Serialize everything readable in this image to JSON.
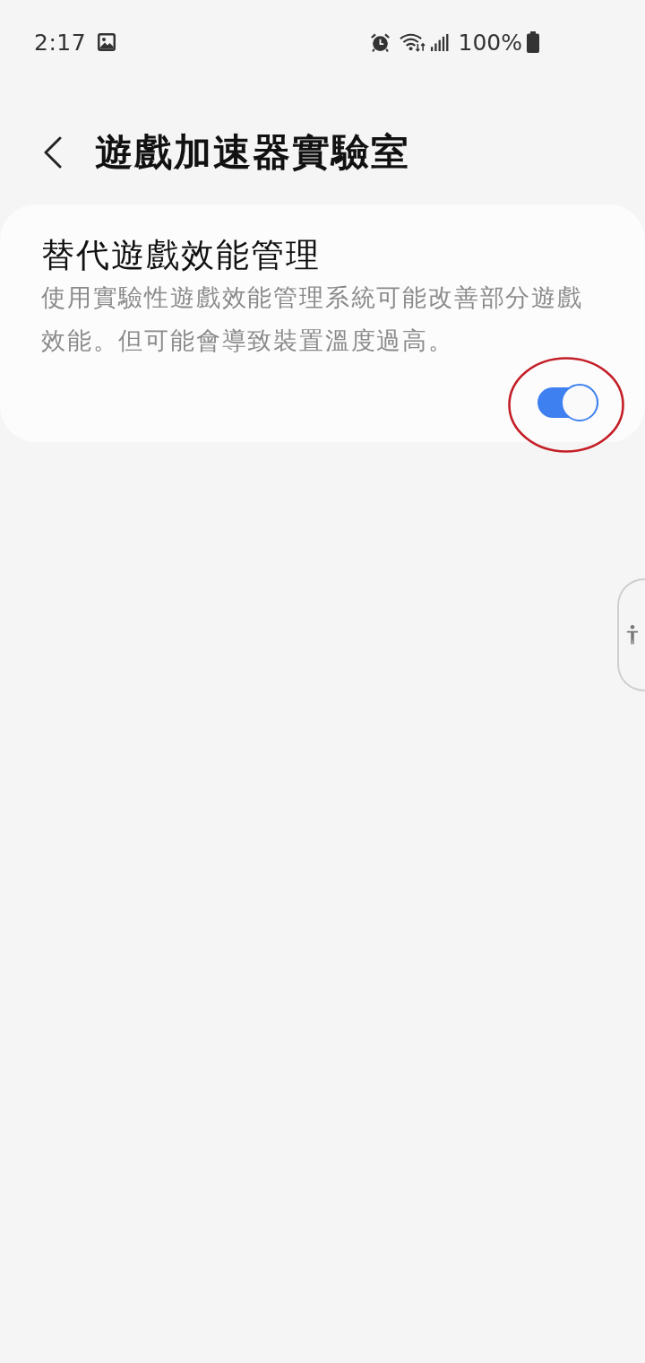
{
  "status_bar": {
    "time": "2:17",
    "battery": "100%"
  },
  "header": {
    "title": "遊戲加速器實驗室"
  },
  "settings": [
    {
      "kind": "switch",
      "title": "替代遊戲效能管理",
      "description": "使用實驗性遊戲效能管理系統可能改善部分遊戲效能。但可能會導致裝置溫度過高。",
      "on": true,
      "highlighted": true
    }
  ]
}
